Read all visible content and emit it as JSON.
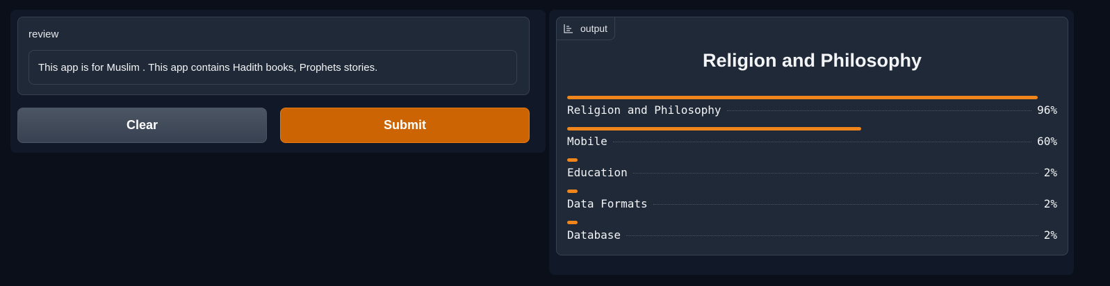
{
  "input": {
    "label": "review",
    "value": "This app is for Muslim . This app contains Hadith books, Prophets stories."
  },
  "buttons": {
    "clear": "Clear",
    "submit": "Submit"
  },
  "output": {
    "tag_label": "output",
    "tag_icon": "bar-chart-icon",
    "title": "Religion and Philosophy",
    "confidences": [
      {
        "label": "Religion and Philosophy",
        "percent_text": "96%",
        "value": 0.96
      },
      {
        "label": "Mobile",
        "percent_text": "60%",
        "value": 0.6
      },
      {
        "label": "Education",
        "percent_text": "2%",
        "value": 0.02
      },
      {
        "label": "Data Formats",
        "percent_text": "2%",
        "value": 0.02
      },
      {
        "label": "Database",
        "percent_text": "2%",
        "value": 0.02
      }
    ]
  },
  "colors": {
    "accent": "#cc6404",
    "bar": "#f0861b",
    "background": "#0b0f19",
    "panel": "#1f2937"
  }
}
